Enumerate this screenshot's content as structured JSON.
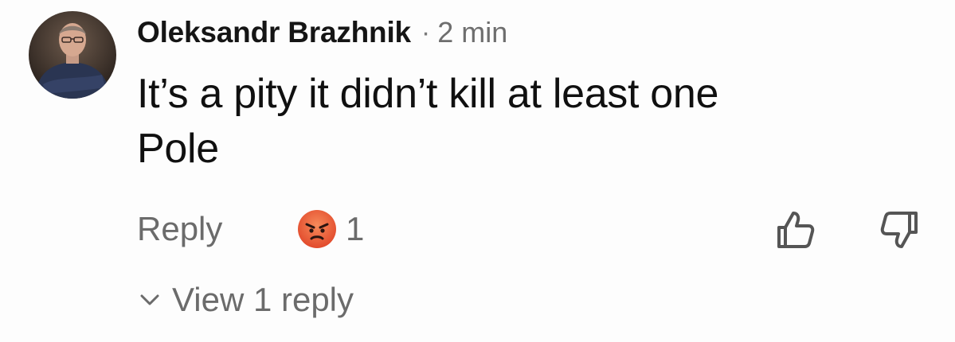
{
  "comment": {
    "author": "Oleksandr Brazhnik",
    "separator": "·",
    "time": "2 min",
    "text_lines": [
      "It’s a pity it didn’t kill at least one",
      "Pole"
    ]
  },
  "actions": {
    "reply_label": "Reply",
    "reaction_icon": "angry-face-icon",
    "reaction_count": "1",
    "like_icon": "thumbs-up-icon",
    "dislike_icon": "thumbs-down-icon"
  },
  "replies": {
    "toggle_icon": "chevron-down-icon",
    "label": "View 1 reply"
  },
  "colors": {
    "author": "#151515",
    "comment_text": "#101010",
    "muted": "#6b6b6b",
    "reaction_face": "#e8502f"
  }
}
